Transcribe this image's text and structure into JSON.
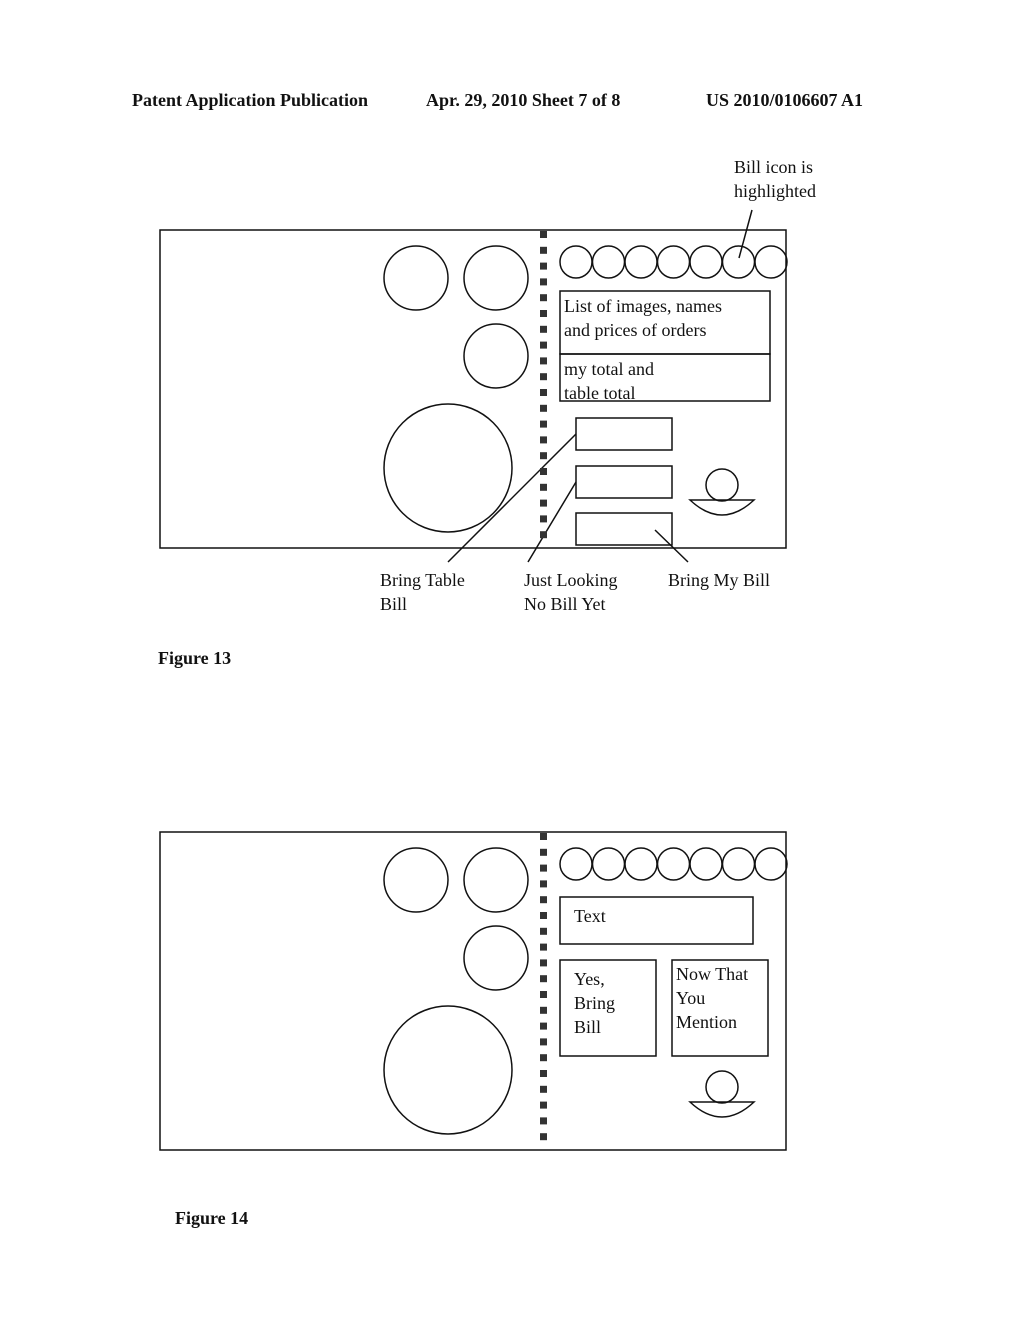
{
  "header": {
    "left": "Patent Application Publication",
    "center": "Apr. 29, 2010  Sheet 7 of 8",
    "right": "US 2010/0106607 A1"
  },
  "figure13": {
    "caption": "Figure 13",
    "callout_bill_icon": "Bill icon is\nhighlighted",
    "order_list_text": "List of images, names\nand prices of orders",
    "totals_text": "my total and\ntable total",
    "label_bring_table_bill": "Bring Table\nBill",
    "label_just_looking": "Just Looking\nNo Bill Yet",
    "label_bring_my_bill": "Bring My Bill",
    "icon_circle_count": 7,
    "highlighted_icon_index": 6
  },
  "figure14": {
    "caption": "Figure 14",
    "text_box": "Text",
    "button_yes": "Yes,\nBring\nBill",
    "button_now": "Now That\nYou\nMention",
    "icon_circle_count": 7
  }
}
